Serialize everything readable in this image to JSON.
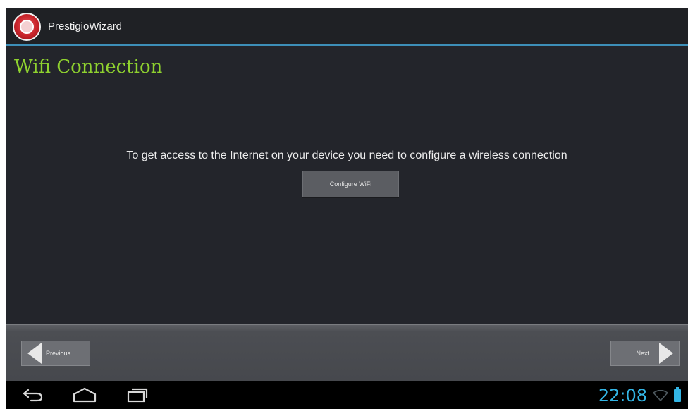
{
  "app": {
    "title": "PrestigioWizard",
    "icon": "prestigio-logo-icon"
  },
  "page": {
    "title": "Wifi Connection",
    "info": "To get access to the Internet on your device you need to configure a wireless connection",
    "configure_label": "Configure WiFi"
  },
  "nav": {
    "previous_label": "Previous",
    "next_label": "Next"
  },
  "system": {
    "time": "22:08",
    "icons": [
      "back-icon",
      "home-icon",
      "recent-apps-icon",
      "wifi-icon",
      "battery-icon"
    ]
  },
  "colors": {
    "accent": "#8fd22f",
    "holo_blue": "#33b5e5",
    "background": "#23252b"
  }
}
